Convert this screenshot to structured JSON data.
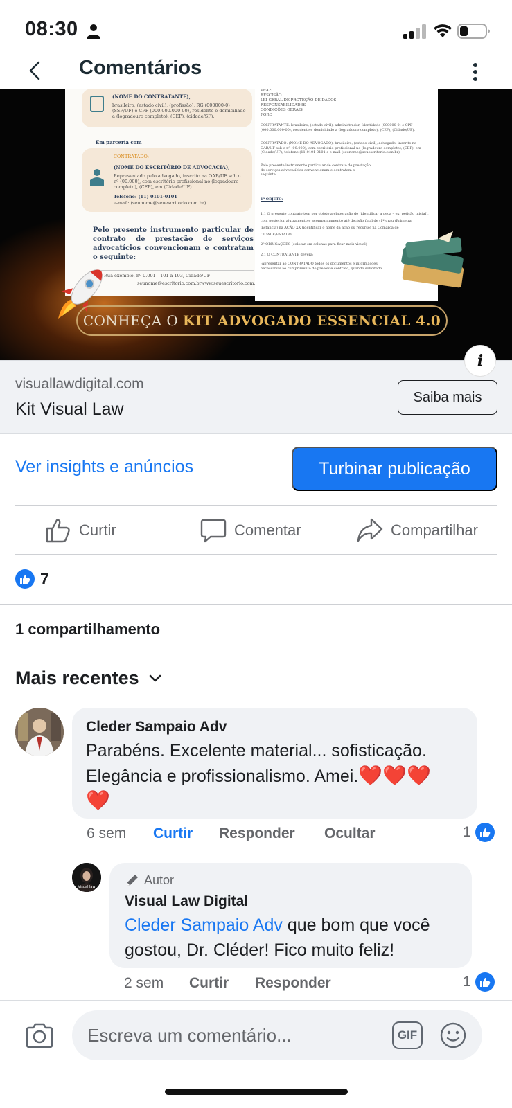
{
  "status_bar": {
    "time": "08:30"
  },
  "header": {
    "title": "Comentários"
  },
  "ad": {
    "doc_left": {
      "contractor_placeholder": "(NOME DO CONTRATANTE),",
      "contractor_details": "brasileiro, (estado civil), (profissão), RG (000000-0) (SSP/UF) e CPF (000.000.000-00), residente e domiciliado a (logradouro completo), (CEP), (cidade/SF).",
      "partnership": "Em parceria com",
      "hired_label": "CONTRATADO:",
      "firm_name": "(NOME DO ESCRITÓRIO DE ADVOCACIA),",
      "firm_details": "Representado pelo advogado, inscrito na OAB/UF sob o nº (00.000), com escritório profissional no (logradouro completo), (CEP), em (Cidade/UF).",
      "phone": "Telefone: (11) 0101-0101",
      "email": "e-mail: (seunome@seuescritorio.com.br)",
      "intro": "Pelo presente instrumento particular de contrato de prestação de serviços advocatícios convencionam e contratam o seguinte:",
      "footer_address": "Rua exemplo, nº 0.001 - 101 a 103, Cidade/UF",
      "footer_email": "seunome@escritorio.com.br",
      "footer_site": "www.seuescritorio.com.br"
    },
    "doc_right": {
      "toc": [
        "PRAZO",
        "RESCISÃO",
        "LEI GERAL DE PROTEÇÃO DE DADOS",
        "RESPONSABILIDADES",
        "CONDIÇÕES GERAIS",
        "FORO"
      ],
      "p1": "CONTRATANTE: brasileiro, (estado civil), administrador, Identidade (000000-0) e CPF (000.000.000-00), residente e domiciliado a (logradouro completo), (CEP), (Cidade/UF).",
      "p2": "CONTRATADO: (NOME DO ADVOGADO), brasileiro, (estado civil), advogado, inscrito na OAB/UF sob o nº (00.000), com escritório profissional no (logradouro completo), (CEP), em (Cidade/UF), telefone (11)0101-0101 e e-mail (seunome@seuescritorio.com.br)",
      "p3": "Pelo presente instrumento particular de contrato de prestação de serviços advocatícios convencionam e contratam o seguinte:",
      "section": "1º OBJETO:",
      "p4": "1.1 O presente contrato tem por objeto a elaboração de (identificar a peça – ex: petição inicial), com posterior ajuizamento e acompanhamento até decisão final de (1º grau (Primeira instância) na AÇÃO XX (identificar o nome da ação ou recurso) na Comarca de CIDADE/ESTADO.",
      "p5": "2º OBRIGAÇÕES (colocar em colunas para ficar mais visual)",
      "p6": "2.1 O CONTRATANTE deverá:",
      "p7": "-Apresentar ao CONTRATADO todos os documentos e informações necessárias ao cumprimento do presente contrato, quando solicitado."
    },
    "banner_prefix": "CONHEÇA O",
    "banner_highlight": "KIT ADVOGADO ESSENCIAL 4.0",
    "info_icon": "i"
  },
  "link_card": {
    "domain": "visuallawdigital.com",
    "title": "Kit Visual Law",
    "button": "Saiba mais"
  },
  "insights": {
    "link": "Ver insights e anúncios",
    "boost": "Turbinar publicação"
  },
  "actions": {
    "like": "Curtir",
    "comment": "Comentar",
    "share": "Compartilhar"
  },
  "reactions": {
    "count": "7"
  },
  "shares": "1 compartilhamento",
  "sort": {
    "label": "Mais recentes"
  },
  "comments": [
    {
      "author": "Cleder Sampaio Adv",
      "text_line1": "Parabéns. Excelente material... sofisticação.",
      "text_line2": "Elegância e profissionalismo. Amei.",
      "hearts": "❤️❤️❤️",
      "heart_last": "❤️",
      "time": "6 sem",
      "like": "Curtir",
      "reply": "Responder",
      "hide": "Ocultar",
      "reaction_count": "1"
    },
    {
      "badge": "Autor",
      "author": "Visual Law Digital",
      "mention": "Cleder Sampaio Adv",
      "text_line1_rest": " que bom que você",
      "text_line2": "gostou, Dr. Cléder! Fico muito feliz!",
      "avatar_text": "Visual law",
      "time": "2 sem",
      "like": "Curtir",
      "reply": "Responder",
      "reaction_count": "1"
    }
  ],
  "composer": {
    "placeholder": "Escreva um comentário...",
    "gif": "GIF"
  },
  "colors": {
    "brand_blue": "#1877f2",
    "heart_red": "#e0242d",
    "muted_text": "#65676b",
    "bubble_bg": "#f0f2f5"
  },
  "icons": [
    "person-icon",
    "signal-icon",
    "wifi-icon",
    "battery-icon",
    "back-arrow-icon",
    "more-vertical-icon",
    "rocket-icon",
    "books-icon",
    "info-icon",
    "thumbs-up-icon",
    "comment-icon",
    "share-icon",
    "like-badge-icon",
    "chevron-down-icon",
    "pencil-icon",
    "camera-icon",
    "gif-icon",
    "emoji-icon"
  ]
}
